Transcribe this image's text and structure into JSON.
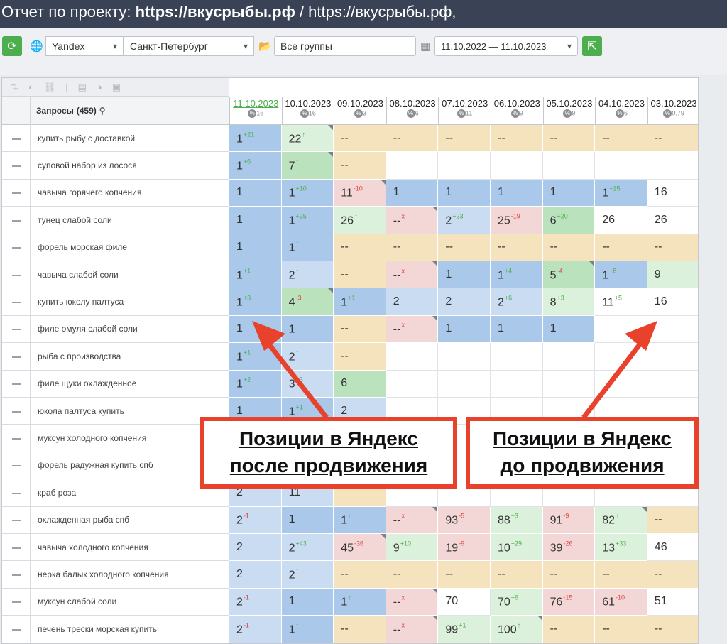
{
  "title": {
    "prefix": "Отчет по проекту: ",
    "bold": "https://вкусрыбы.рф",
    "suffix": " / https://вкусрыбы.рф,"
  },
  "toolbar": {
    "engine": "Yandex",
    "region": "Санкт-Петербург",
    "group": "Все группы",
    "period": "11.10.2022 — 11.10.2023"
  },
  "table": {
    "queries_label": "Запросы",
    "queries_count": "(459)",
    "dates": [
      {
        "date": "11.10.2023",
        "pct": "16"
      },
      {
        "date": "10.10.2023",
        "pct": "16"
      },
      {
        "date": "09.10.2023",
        "pct": "3"
      },
      {
        "date": "08.10.2023",
        "pct": "6"
      },
      {
        "date": "07.10.2023",
        "pct": "11"
      },
      {
        "date": "06.10.2023",
        "pct": "9"
      },
      {
        "date": "05.10.2023",
        "pct": "9"
      },
      {
        "date": "04.10.2023",
        "pct": "6"
      },
      {
        "date": "03.10.2023",
        "pct": "0.79"
      }
    ],
    "rows": [
      {
        "q": "купить рыбу с доставкой",
        "cells": [
          [
            "1",
            "+21",
            "blue",
            0
          ],
          [
            "22",
            "↑",
            "lgreen",
            1
          ],
          [
            "--",
            "",
            "tan",
            0
          ],
          [
            "--",
            "",
            "tan",
            0
          ],
          [
            "--",
            "",
            "tan",
            0
          ],
          [
            "--",
            "",
            "tan",
            0
          ],
          [
            "--",
            "",
            "tan",
            0
          ],
          [
            "--",
            "",
            "tan",
            0
          ],
          [
            "--",
            "",
            "tan",
            0
          ]
        ]
      },
      {
        "q": "суповой набор из лосося",
        "cells": [
          [
            "1",
            "+6",
            "blue",
            0
          ],
          [
            "7",
            "↑",
            "green",
            1
          ],
          [
            "--",
            "",
            "tan",
            0
          ],
          [
            "",
            "",
            "empty",
            0
          ],
          [
            "",
            "",
            "empty",
            0
          ],
          [
            "",
            "",
            "empty",
            0
          ],
          [
            "",
            "",
            "empty",
            0
          ],
          [
            "",
            "",
            "empty",
            0
          ],
          [
            "",
            "",
            "empty",
            0
          ]
        ]
      },
      {
        "q": "чавыча горячего копчения",
        "cells": [
          [
            "1",
            "",
            "blue",
            0
          ],
          [
            "1",
            "+10",
            "blue",
            0
          ],
          [
            "11",
            "-10",
            "pink",
            1
          ],
          [
            "1",
            "",
            "blue",
            0
          ],
          [
            "1",
            "",
            "blue",
            0
          ],
          [
            "1",
            "",
            "blue",
            0
          ],
          [
            "1",
            "",
            "blue",
            0
          ],
          [
            "1",
            "+15",
            "blue",
            0
          ],
          [
            "16",
            "",
            "white",
            0
          ]
        ]
      },
      {
        "q": "тунец слабой соли",
        "cells": [
          [
            "1",
            "",
            "blue",
            0
          ],
          [
            "1",
            "+25",
            "blue",
            0
          ],
          [
            "26",
            "↑",
            "lgreen",
            0
          ],
          [
            "--",
            "x",
            "pink",
            1
          ],
          [
            "2",
            "+23",
            "lblue",
            0
          ],
          [
            "25",
            "-19",
            "pink",
            0
          ],
          [
            "6",
            "+20",
            "green",
            0
          ],
          [
            "26",
            "",
            "white",
            0
          ],
          [
            "26",
            "",
            "white",
            0
          ]
        ]
      },
      {
        "q": "форель морская филе",
        "cells": [
          [
            "1",
            "",
            "blue",
            0
          ],
          [
            "1",
            "↑",
            "blue",
            0
          ],
          [
            "--",
            "",
            "tan",
            0
          ],
          [
            "--",
            "",
            "tan",
            0
          ],
          [
            "--",
            "",
            "tan",
            0
          ],
          [
            "--",
            "",
            "tan",
            0
          ],
          [
            "--",
            "",
            "tan",
            0
          ],
          [
            "--",
            "",
            "tan",
            0
          ],
          [
            "--",
            "",
            "tan",
            0
          ]
        ]
      },
      {
        "q": "чавыча слабой соли",
        "cells": [
          [
            "1",
            "+1",
            "blue",
            0
          ],
          [
            "2",
            "↑",
            "lblue",
            0
          ],
          [
            "--",
            "",
            "tan",
            0
          ],
          [
            "--",
            "x",
            "pink",
            1
          ],
          [
            "1",
            "",
            "blue",
            0
          ],
          [
            "1",
            "+4",
            "blue",
            0
          ],
          [
            "5",
            "-4",
            "green",
            1
          ],
          [
            "1",
            "+8",
            "blue",
            0
          ],
          [
            "9",
            "",
            "lgreen",
            0
          ]
        ]
      },
      {
        "q": "купить юколу палтуса",
        "cells": [
          [
            "1",
            "+3",
            "blue",
            0
          ],
          [
            "4",
            "-3",
            "green",
            1
          ],
          [
            "1",
            "+1",
            "blue",
            0
          ],
          [
            "2",
            "",
            "lblue",
            0
          ],
          [
            "2",
            "",
            "lblue",
            0
          ],
          [
            "2",
            "+6",
            "lblue",
            0
          ],
          [
            "8",
            "+3",
            "lgreen",
            0
          ],
          [
            "11",
            "+5",
            "white",
            0
          ],
          [
            "16",
            "",
            "white",
            0
          ]
        ]
      },
      {
        "q": "филе омуля слабой соли",
        "cells": [
          [
            "1",
            "",
            "blue",
            0
          ],
          [
            "1",
            "↑",
            "blue",
            0
          ],
          [
            "--",
            "",
            "tan",
            0
          ],
          [
            "--",
            "x",
            "pink",
            1
          ],
          [
            "1",
            "",
            "blue",
            0
          ],
          [
            "1",
            "",
            "blue",
            0
          ],
          [
            "1",
            "",
            "blue",
            0
          ],
          [
            "",
            "",
            "empty",
            0
          ],
          [
            "",
            "",
            "empty",
            0
          ]
        ]
      },
      {
        "q": "рыба с производства",
        "cells": [
          [
            "1",
            "+1",
            "blue",
            0
          ],
          [
            "2",
            "↑",
            "lblue",
            0
          ],
          [
            "--",
            "",
            "tan",
            0
          ],
          [
            "",
            "",
            "empty",
            0
          ],
          [
            "",
            "",
            "empty",
            0
          ],
          [
            "",
            "",
            "empty",
            0
          ],
          [
            "",
            "",
            "empty",
            0
          ],
          [
            "",
            "",
            "empty",
            0
          ],
          [
            "",
            "",
            "empty",
            0
          ]
        ]
      },
      {
        "q": "филе щуки охлажденное",
        "cells": [
          [
            "1",
            "+2",
            "blue",
            0
          ],
          [
            "3",
            "+3",
            "lblue",
            0
          ],
          [
            "6",
            "",
            "green",
            0
          ],
          [
            "",
            "",
            "empty",
            0
          ],
          [
            "",
            "",
            "empty",
            0
          ],
          [
            "",
            "",
            "empty",
            0
          ],
          [
            "",
            "",
            "empty",
            0
          ],
          [
            "",
            "",
            "empty",
            0
          ],
          [
            "",
            "",
            "empty",
            0
          ]
        ]
      },
      {
        "q": "юкола палтуса купить",
        "cells": [
          [
            "1",
            "",
            "blue",
            0
          ],
          [
            "1",
            "+1",
            "blue",
            0
          ],
          [
            "2",
            "",
            "lblue",
            0
          ],
          [
            "",
            "",
            "empty",
            0
          ],
          [
            "",
            "",
            "empty",
            0
          ],
          [
            "",
            "",
            "empty",
            0
          ],
          [
            "",
            "",
            "empty",
            0
          ],
          [
            "",
            "",
            "empty",
            0
          ],
          [
            "",
            "",
            "empty",
            0
          ]
        ]
      },
      {
        "q": "муксун холодного копчения",
        "cells": [
          [
            "",
            "",
            "lblue",
            0
          ],
          [
            "",
            "",
            "lblue",
            0
          ],
          [
            "",
            "",
            "tan",
            0
          ],
          [
            "",
            "",
            "empty",
            0
          ],
          [
            "",
            "",
            "empty",
            0
          ],
          [
            "",
            "",
            "empty",
            0
          ],
          [
            "",
            "",
            "empty",
            0
          ],
          [
            "",
            "",
            "empty",
            0
          ],
          [
            "",
            "",
            "empty",
            0
          ]
        ]
      },
      {
        "q": "форель радужная купить спб",
        "cells": [
          [
            "",
            "",
            "lblue",
            0
          ],
          [
            "",
            "",
            "lblue",
            0
          ],
          [
            "",
            "",
            "tan",
            0
          ],
          [
            "",
            "",
            "empty",
            0
          ],
          [
            "",
            "",
            "empty",
            0
          ],
          [
            "",
            "",
            "empty",
            0
          ],
          [
            "",
            "",
            "empty",
            0
          ],
          [
            "",
            "",
            "empty",
            0
          ],
          [
            "",
            "",
            "empty",
            0
          ]
        ]
      },
      {
        "q": "краб роза",
        "cells": [
          [
            "2",
            "",
            "lblue",
            0
          ],
          [
            "11",
            "",
            "lblue",
            0
          ],
          [
            "",
            "",
            "tan",
            0
          ],
          [
            "",
            "",
            "empty",
            0
          ],
          [
            "",
            "",
            "empty",
            0
          ],
          [
            "",
            "",
            "empty",
            0
          ],
          [
            "",
            "",
            "empty",
            0
          ],
          [
            "",
            "",
            "empty",
            0
          ],
          [
            "",
            "",
            "empty",
            0
          ]
        ]
      },
      {
        "q": "охлажденная рыба спб",
        "cells": [
          [
            "2",
            "-1",
            "lblue",
            0
          ],
          [
            "1",
            "",
            "blue",
            0
          ],
          [
            "1",
            "↑",
            "blue",
            0
          ],
          [
            "--",
            "x",
            "pink",
            1
          ],
          [
            "93",
            "-5",
            "pink",
            0
          ],
          [
            "88",
            "+3",
            "lgreen",
            0
          ],
          [
            "91",
            "-9",
            "pink",
            0
          ],
          [
            "82",
            "↑",
            "lgreen",
            1
          ],
          [
            "--",
            "",
            "tan",
            0
          ]
        ]
      },
      {
        "q": "чавыча холодного копчения",
        "cells": [
          [
            "2",
            "",
            "lblue",
            0
          ],
          [
            "2",
            "+43",
            "lblue",
            0
          ],
          [
            "45",
            "-36",
            "pink",
            1
          ],
          [
            "9",
            "+10",
            "lgreen",
            0
          ],
          [
            "19",
            "-9",
            "pink",
            0
          ],
          [
            "10",
            "+29",
            "lgreen",
            0
          ],
          [
            "39",
            "-26",
            "pink",
            0
          ],
          [
            "13",
            "+33",
            "lgreen",
            0
          ],
          [
            "46",
            "",
            "white",
            0
          ]
        ]
      },
      {
        "q": "нерка балык холодного копчения",
        "cells": [
          [
            "2",
            "",
            "lblue",
            0
          ],
          [
            "2",
            "↑",
            "lblue",
            0
          ],
          [
            "--",
            "",
            "tan",
            0
          ],
          [
            "--",
            "",
            "tan",
            0
          ],
          [
            "--",
            "",
            "tan",
            0
          ],
          [
            "--",
            "",
            "tan",
            0
          ],
          [
            "--",
            "",
            "tan",
            0
          ],
          [
            "--",
            "",
            "tan",
            0
          ],
          [
            "--",
            "",
            "tan",
            0
          ]
        ]
      },
      {
        "q": "муксун слабой соли",
        "cells": [
          [
            "2",
            "-1",
            "lblue",
            0
          ],
          [
            "1",
            "",
            "blue",
            0
          ],
          [
            "1",
            "↑",
            "blue",
            0
          ],
          [
            "--",
            "x",
            "pink",
            1
          ],
          [
            "70",
            "",
            "white",
            0
          ],
          [
            "70",
            "+6",
            "lgreen",
            0
          ],
          [
            "76",
            "-15",
            "pink",
            0
          ],
          [
            "61",
            "-10",
            "pink",
            0
          ],
          [
            "51",
            "",
            "white",
            0
          ]
        ]
      },
      {
        "q": "печень трески морская купить",
        "cells": [
          [
            "2",
            "-1",
            "lblue",
            0
          ],
          [
            "1",
            "↑",
            "blue",
            0
          ],
          [
            "--",
            "",
            "tan",
            0
          ],
          [
            "--",
            "x",
            "pink",
            1
          ],
          [
            "99",
            "+1",
            "lgreen",
            0
          ],
          [
            "100",
            "↑",
            "lgreen",
            1
          ],
          [
            "--",
            "",
            "tan",
            0
          ],
          [
            "--",
            "",
            "tan",
            0
          ],
          [
            "--",
            "",
            "tan",
            0
          ]
        ]
      }
    ]
  },
  "callouts": {
    "after_line1": "Позиции в Яндекс",
    "after_line2": "после продвижения",
    "before_line1": "Позиции в Яндекс",
    "before_line2": "до продвижения"
  },
  "colors": {
    "accent_green": "#4cae4c",
    "title_bg": "#3a4356",
    "callout_red": "#e8412c",
    "up": "#4cae4c",
    "down": "#e04040"
  },
  "icons": [
    "refresh-icon",
    "globe-icon",
    "folder-icon",
    "calendar-icon",
    "export-icon",
    "sort-icon",
    "search-icon"
  ]
}
